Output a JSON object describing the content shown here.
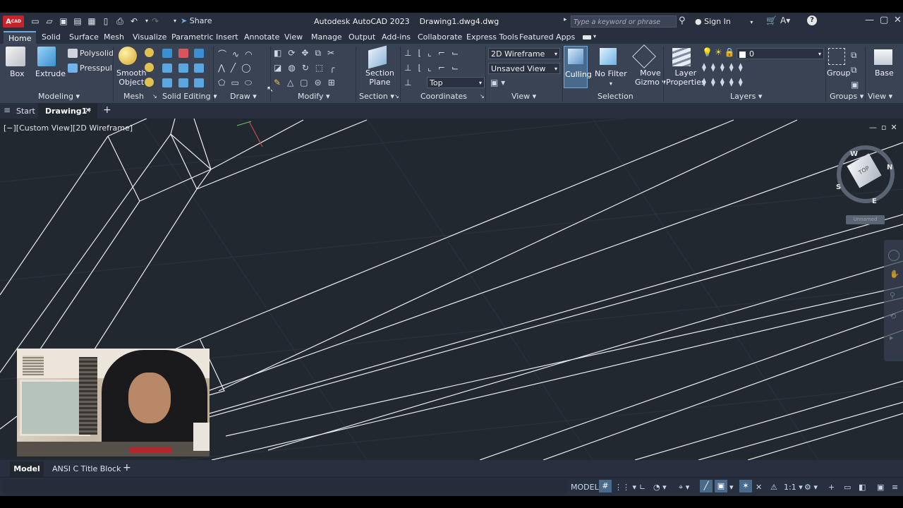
{
  "app": {
    "badge": "A",
    "badge_sub": "CAD",
    "title": "Autodesk AutoCAD 2023    Drawing1.dwg4.dwg"
  },
  "quick_access": {
    "share_label": "Share"
  },
  "search": {
    "placeholder": "Type a keyword or phrase"
  },
  "account": {
    "signin_label": "Sign In"
  },
  "ribbon_tabs": [
    "Home",
    "Solid",
    "Surface",
    "Mesh",
    "Visualize",
    "Parametric",
    "Insert",
    "Annotate",
    "View",
    "Manage",
    "Output",
    "Add-ins",
    "Collaborate",
    "Express Tools",
    "Featured Apps"
  ],
  "ribbon": {
    "modeling": {
      "box": "Box",
      "extrude": "Extrude",
      "polysolid": "Polysolid",
      "presspull": "Presspull",
      "label": "Modeling"
    },
    "mesh": {
      "smooth": "Smooth",
      "object": "Object",
      "label": "Mesh"
    },
    "solid_editing": {
      "label": "Solid Editing"
    },
    "draw": {
      "label": "Draw"
    },
    "modify": {
      "label": "Modify"
    },
    "section": {
      "section": "Section",
      "plane": "Plane",
      "label": "Section"
    },
    "coordinates": {
      "label": "Coordinates",
      "top_value": "Top"
    },
    "view": {
      "visual_style": "2D Wireframe",
      "view_name": "Unsaved View",
      "label": "View"
    },
    "selection": {
      "culling": "Culling",
      "no_filter": "No Filter",
      "move": "Move",
      "gizmo": "Gizmo",
      "label": "Selection"
    },
    "layers": {
      "layer": "Layer",
      "properties": "Properties",
      "current": "0",
      "label": "Layers"
    },
    "groups": {
      "group": "Group",
      "label": "Groups"
    },
    "view2": {
      "base": "Base",
      "label": "View"
    }
  },
  "doc_tabs": {
    "start": "Start",
    "active": "Drawing1*"
  },
  "viewport": {
    "label": "[−][Custom View][2D Wireframe]",
    "unnamed": "Unnamed"
  },
  "viewcube": {
    "face": "TOP",
    "n": "N",
    "s": "S",
    "w": "W",
    "e": "E"
  },
  "layout_tabs": [
    "Model",
    "ANSI C Title Block"
  ],
  "status": {
    "model": "MODEL",
    "scale": "1:1"
  },
  "colors": {
    "accent": "#6fa8dc",
    "canvas": "#212830",
    "ribbon": "#3a4354",
    "title_red": "#c8232c"
  }
}
